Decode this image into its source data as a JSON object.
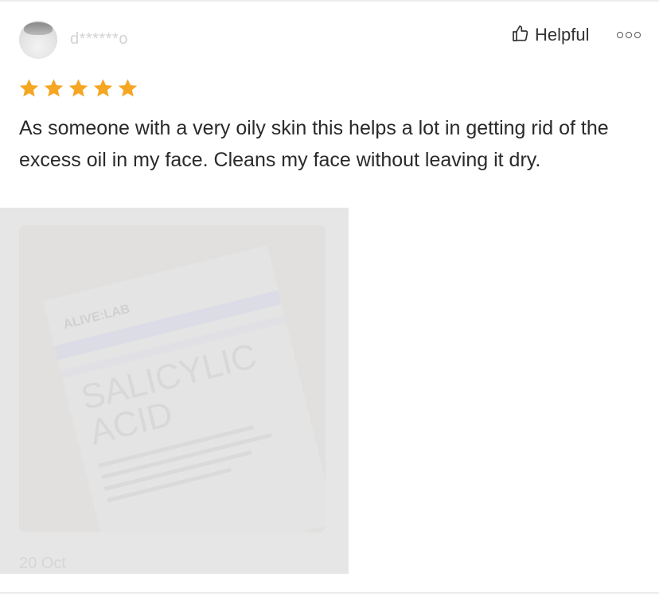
{
  "review": {
    "username": "d******o",
    "rating": 5,
    "rating_color": "#f5a623",
    "helpful_label": "Helpful",
    "helpful_icon": "thumbs-up-icon",
    "more_icon": "more-options-icon",
    "text": "As someone with a very oily skin this helps a lot in getting rid of the excess oil in my face. Cleans my face without leaving it dry.",
    "photo": {
      "brand": "ALIVE:LAB",
      "product_line1": "SALICYLIC",
      "product_line2": "ACID"
    },
    "date": "20 Oct"
  }
}
